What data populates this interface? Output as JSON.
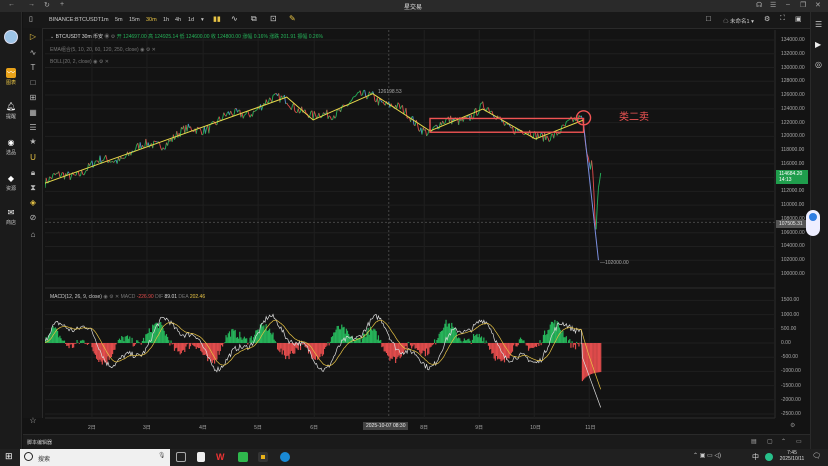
{
  "window": {
    "title": "星交易"
  },
  "app_sidebar": {
    "items": [
      {
        "label": "图表",
        "icon": "chart-icon"
      },
      {
        "label": "提醒",
        "icon": "bell-icon"
      },
      {
        "label": "选品",
        "icon": "search-chat-icon"
      },
      {
        "label": "资源",
        "icon": "diamond-icon"
      },
      {
        "label": "商店",
        "icon": "store-icon"
      }
    ]
  },
  "toolbar": {
    "symbol": "BINANCE:BTCUSDT",
    "intervals": [
      "1m",
      "5m",
      "15m",
      "30m",
      "1h",
      "4h",
      "1d"
    ],
    "active_interval": "30m",
    "layout_label": "未命名1"
  },
  "legend": {
    "symbol_line": "BTC/USDT 30m 币安",
    "ohlc": "开 124697.00 高 124925.14 低 124600.00 收 124800.00 涨幅 0.16% 涨跌 201.91 振幅 0.26%",
    "ema": "EMA组合(5, 10, 20, 60, 120, 250, close)",
    "boll": "BOLL(20, 2, close)",
    "macd_name": "MACD(12, 26, 9, close)",
    "macd_label": "MACD",
    "macd_value": "-226.90",
    "dif_label": "DIF",
    "dif_value": "89.01",
    "dea_label": "DEA",
    "dea_value": "202.46"
  },
  "price_axis": [
    "134000.00",
    "132000.00",
    "130000.00",
    "128000.00",
    "126000.00",
    "124000.00",
    "122000.00",
    "120000.00",
    "118000.00",
    "116000.00",
    "114000.00",
    "112000.00",
    "110000.00",
    "108000.00",
    "106000.00",
    "104000.00",
    "102000.00",
    "100000.00"
  ],
  "macd_axis": [
    "1500.00",
    "1000.00",
    "500.00",
    "0.00",
    "-500.00",
    "-1000.00",
    "-1500.00",
    "-2000.00",
    "-2500.00"
  ],
  "x_axis": [
    {
      "label": "2日",
      "bar": 41
    },
    {
      "label": "3日",
      "bar": 89
    },
    {
      "label": "4日",
      "bar": 138
    },
    {
      "label": "5日",
      "bar": 186
    },
    {
      "label": "6日",
      "bar": 235
    },
    {
      "label": "8日",
      "bar": 331
    },
    {
      "label": "9日",
      "bar": 379
    },
    {
      "label": "10日",
      "bar": 427
    },
    {
      "label": "11日",
      "bar": 475
    }
  ],
  "crosshair_time": "2025-10-07  08:30",
  "last_price": {
    "value": "114684.20",
    "countdown": "14:13"
  },
  "crosshair_price": "107505.31",
  "annotations": {
    "high_label": "126198.53",
    "low_label": "102000.00",
    "signal_text": "类二卖"
  },
  "chart_data": {
    "type": "line",
    "zigzag": [
      [
        0,
        113200
      ],
      [
        211,
        125700
      ],
      [
        234,
        122380
      ],
      [
        286,
        126198.53
      ],
      [
        336,
        120780
      ],
      [
        382,
        123970
      ],
      [
        428,
        119620
      ],
      [
        470,
        122380
      ]
    ],
    "drop_line": [
      [
        470,
        121800
      ],
      [
        483,
        102000
      ]
    ],
    "box": {
      "bar_from": 336,
      "bar_to": 470,
      "price_top": 122600,
      "price_bottom": 120600
    },
    "price_range": [
      100000,
      134000
    ],
    "macd_range": [
      -2500,
      1500
    ]
  },
  "colors": {
    "up": "#26b45a",
    "down": "#e24c4c",
    "zigzag": "#e6d84a",
    "accent": "#e8c445",
    "box": "#f05454"
  },
  "bottom_panel": {
    "label": "脚本编辑器"
  },
  "taskbar": {
    "search_placeholder": "搜索",
    "time": "7:45",
    "date": "2025/10/11",
    "ime": "中"
  }
}
